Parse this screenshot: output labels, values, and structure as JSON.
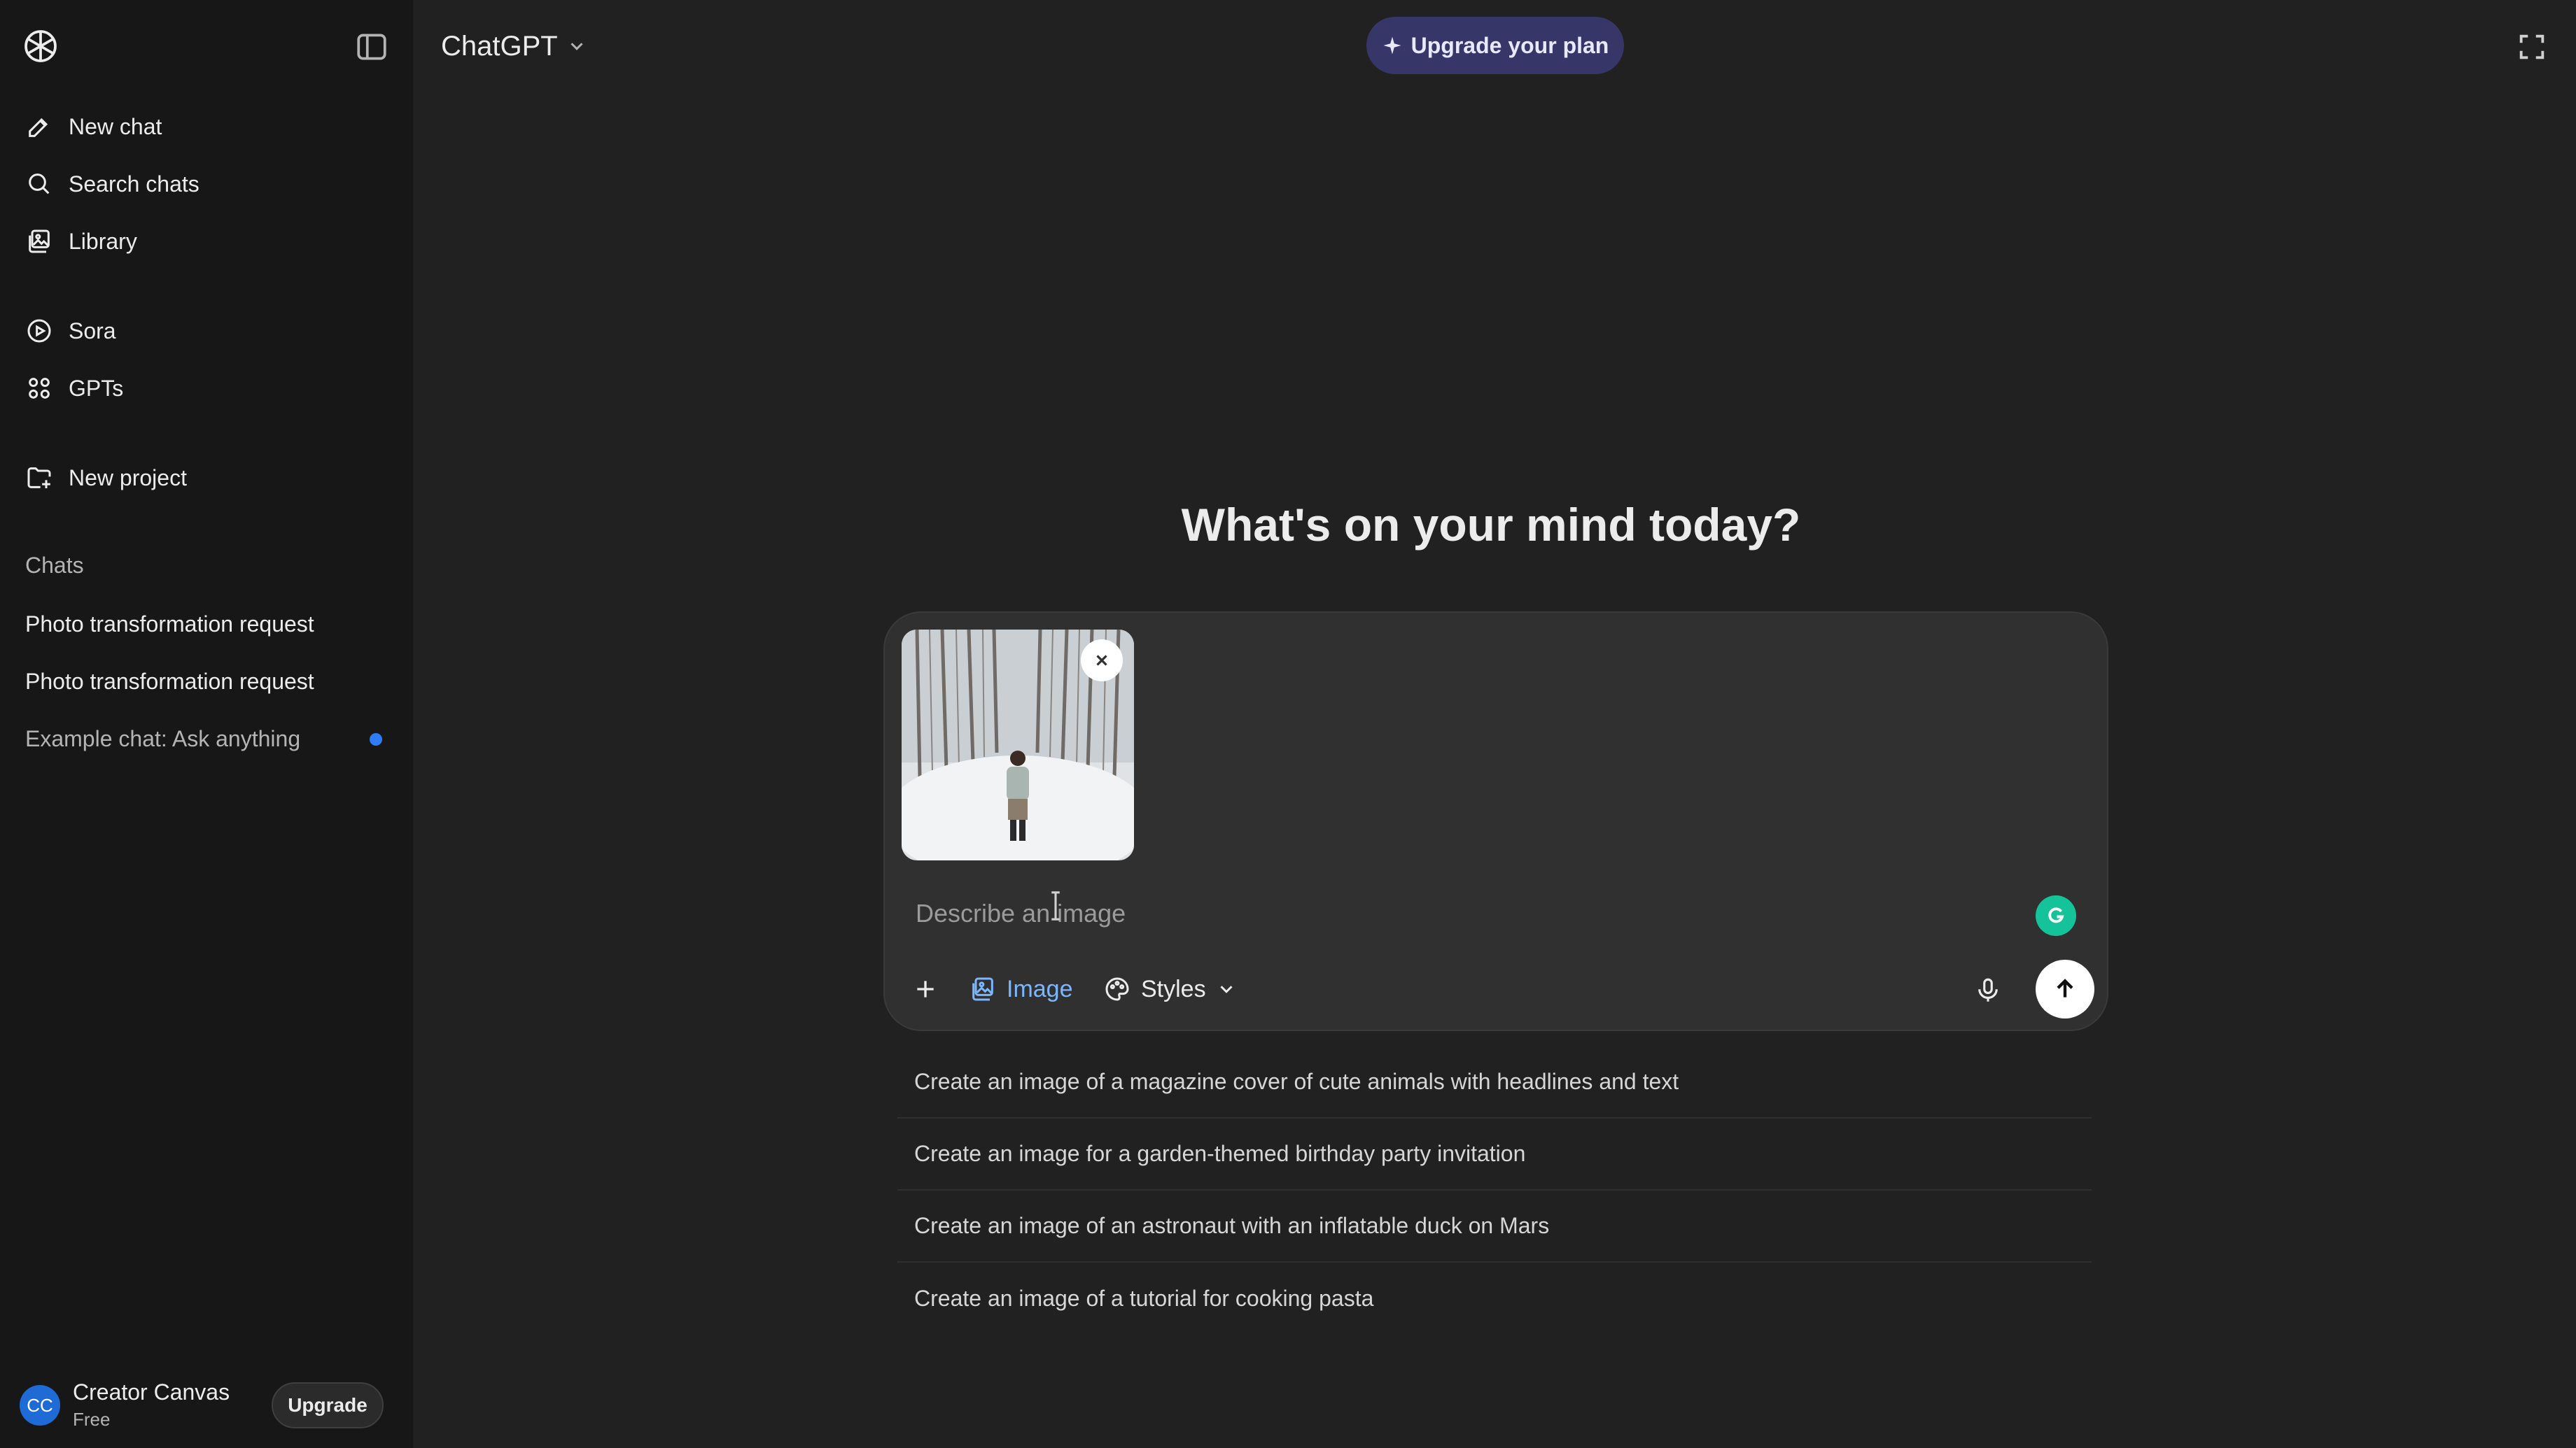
{
  "sidebar": {
    "nav": [
      {
        "label": "New chat",
        "icon": "edit-icon"
      },
      {
        "label": "Search chats",
        "icon": "search-icon"
      },
      {
        "label": "Library",
        "icon": "library-icon"
      },
      {
        "label": "Sora",
        "icon": "play-circle-icon"
      },
      {
        "label": "GPTs",
        "icon": "grid-icon"
      },
      {
        "label": "New project",
        "icon": "folder-plus-icon"
      }
    ],
    "chats_label": "Chats",
    "chats": [
      {
        "label": "Photo transformation request"
      },
      {
        "label": "Photo transformation request"
      },
      {
        "label": "Example chat: Ask anything",
        "unread": true
      }
    ],
    "user": {
      "initials": "CC",
      "name": "Creator Canvas",
      "plan": "Free",
      "upgrade_label": "Upgrade"
    }
  },
  "header": {
    "model": "ChatGPT",
    "upgrade_plan_label": "Upgrade your plan"
  },
  "main": {
    "headline": "What's on your mind today?",
    "composer": {
      "placeholder": "Describe an image",
      "value": "",
      "tools": {
        "image_label": "Image",
        "styles_label": "Styles"
      }
    },
    "suggestions": [
      "Create an image of a magazine cover of cute animals with headlines and text",
      "Create an image for a garden-themed birthday party invitation",
      "Create an image of an astronaut with an inflatable duck on Mars",
      "Create an image of a tutorial for cooking pasta"
    ]
  },
  "colors": {
    "sidebar_bg": "#171717",
    "main_bg": "#212121",
    "composer_bg": "#303030",
    "upgrade_plan_bg": "#373669",
    "accent_blue": "#7ab7ff",
    "unread_dot": "#2e7cf6"
  }
}
